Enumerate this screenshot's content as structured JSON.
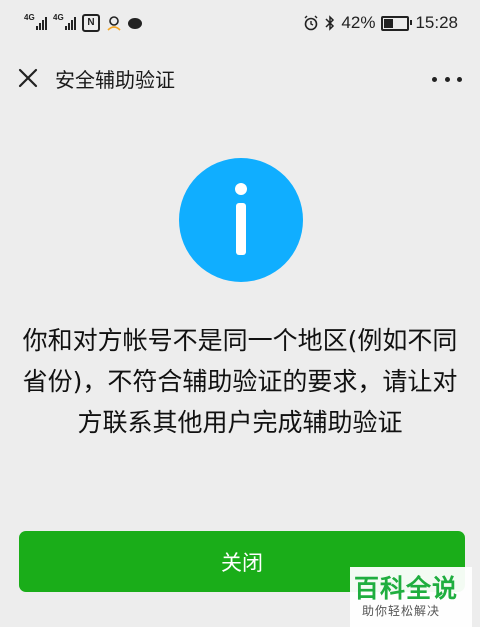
{
  "status_bar": {
    "signal1_label": "4G",
    "signal2_label": "4G",
    "nfc_label": "N",
    "battery_percent": "42%",
    "battery_level": 0.42,
    "time": "15:28"
  },
  "nav": {
    "title": "安全辅助验证"
  },
  "main": {
    "message": "你和对方帐号不是同一个地区(例如不同省份)，不符合辅助验证的要求，请让对方联系其他用户完成辅助验证",
    "close_label": "关闭",
    "info_color": "#10aeff",
    "button_color": "#1aad19"
  },
  "watermark": {
    "main": "百科全说",
    "sub": "助你轻松解决"
  }
}
